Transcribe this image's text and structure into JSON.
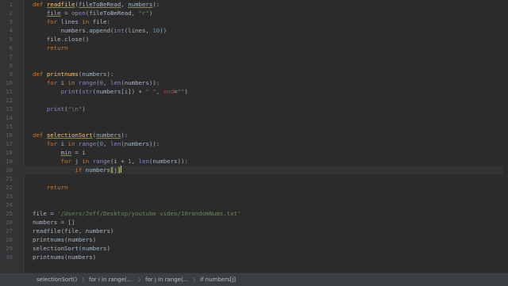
{
  "lines": [
    {
      "n": "1",
      "tokens": [
        {
          "t": "def ",
          "c": "kw"
        },
        {
          "t": "readfile",
          "c": "fn uline"
        },
        {
          "t": "(",
          "c": ""
        },
        {
          "t": "fileToBeRead",
          "c": "param uline"
        },
        {
          "t": ", ",
          "c": ""
        },
        {
          "t": "numbers",
          "c": "param uline"
        },
        {
          "t": "):",
          "c": ""
        }
      ]
    },
    {
      "n": "2",
      "tokens": [
        {
          "t": "    ",
          "c": ""
        },
        {
          "t": "file",
          "c": "uline"
        },
        {
          "t": " = ",
          "c": ""
        },
        {
          "t": "open",
          "c": "builtin"
        },
        {
          "t": "(fileToBeRead, ",
          "c": ""
        },
        {
          "t": "\"r\"",
          "c": "str"
        },
        {
          "t": ")",
          "c": ""
        }
      ]
    },
    {
      "n": "3",
      "tokens": [
        {
          "t": "    ",
          "c": ""
        },
        {
          "t": "for ",
          "c": "kw"
        },
        {
          "t": "lines ",
          "c": ""
        },
        {
          "t": "in ",
          "c": "kw"
        },
        {
          "t": "file:",
          "c": ""
        }
      ]
    },
    {
      "n": "4",
      "tokens": [
        {
          "t": "        numbers.append(",
          "c": ""
        },
        {
          "t": "int",
          "c": "builtin"
        },
        {
          "t": "(lines, ",
          "c": ""
        },
        {
          "t": "10",
          "c": "num"
        },
        {
          "t": "))",
          "c": ""
        }
      ]
    },
    {
      "n": "5",
      "tokens": [
        {
          "t": "    file.close()",
          "c": ""
        }
      ]
    },
    {
      "n": "6",
      "tokens": [
        {
          "t": "    ",
          "c": ""
        },
        {
          "t": "return",
          "c": "kw"
        }
      ]
    },
    {
      "n": "7",
      "tokens": []
    },
    {
      "n": "8",
      "tokens": []
    },
    {
      "n": "9",
      "tokens": [
        {
          "t": "def ",
          "c": "kw"
        },
        {
          "t": "printnums",
          "c": "fn"
        },
        {
          "t": "(numbers):",
          "c": ""
        }
      ]
    },
    {
      "n": "10",
      "tokens": [
        {
          "t": "    ",
          "c": ""
        },
        {
          "t": "for ",
          "c": "kw"
        },
        {
          "t": "i ",
          "c": ""
        },
        {
          "t": "in ",
          "c": "kw"
        },
        {
          "t": "range",
          "c": "builtin"
        },
        {
          "t": "(",
          "c": ""
        },
        {
          "t": "0",
          "c": "num"
        },
        {
          "t": ", ",
          "c": ""
        },
        {
          "t": "len",
          "c": "builtin"
        },
        {
          "t": "(numbers)):",
          "c": ""
        }
      ]
    },
    {
      "n": "11",
      "tokens": [
        {
          "t": "        ",
          "c": ""
        },
        {
          "t": "print",
          "c": "builtin"
        },
        {
          "t": "(",
          "c": ""
        },
        {
          "t": "str",
          "c": "builtin"
        },
        {
          "t": "(numbers[i]) + ",
          "c": ""
        },
        {
          "t": "\" \"",
          "c": "str"
        },
        {
          "t": ", ",
          "c": ""
        },
        {
          "t": "end",
          "c": "kwarg"
        },
        {
          "t": "=",
          "c": ""
        },
        {
          "t": "\"\"",
          "c": "str"
        },
        {
          "t": ")",
          "c": ""
        }
      ]
    },
    {
      "n": "12",
      "tokens": []
    },
    {
      "n": "13",
      "tokens": [
        {
          "t": "    ",
          "c": ""
        },
        {
          "t": "print",
          "c": "builtin"
        },
        {
          "t": "(",
          "c": ""
        },
        {
          "t": "\"\\n\"",
          "c": "str"
        },
        {
          "t": ")",
          "c": ""
        }
      ]
    },
    {
      "n": "14",
      "tokens": []
    },
    {
      "n": "15",
      "tokens": []
    },
    {
      "n": "16",
      "tokens": [
        {
          "t": "def ",
          "c": "kw"
        },
        {
          "t": "selectionSort",
          "c": "fn uline"
        },
        {
          "t": "(",
          "c": ""
        },
        {
          "t": "numbers",
          "c": "uline"
        },
        {
          "t": "):",
          "c": ""
        }
      ]
    },
    {
      "n": "17",
      "tokens": [
        {
          "t": "    ",
          "c": ""
        },
        {
          "t": "for ",
          "c": "kw"
        },
        {
          "t": "i ",
          "c": ""
        },
        {
          "t": "in ",
          "c": "kw"
        },
        {
          "t": "range",
          "c": "builtin"
        },
        {
          "t": "(",
          "c": ""
        },
        {
          "t": "0",
          "c": "num"
        },
        {
          "t": ", ",
          "c": ""
        },
        {
          "t": "len",
          "c": "builtin"
        },
        {
          "t": "(numbers)):",
          "c": ""
        }
      ]
    },
    {
      "n": "18",
      "tokens": [
        {
          "t": "        ",
          "c": ""
        },
        {
          "t": "min",
          "c": "uline"
        },
        {
          "t": " = i",
          "c": ""
        }
      ]
    },
    {
      "n": "19",
      "tokens": [
        {
          "t": "        ",
          "c": ""
        },
        {
          "t": "for ",
          "c": "kw"
        },
        {
          "t": "j ",
          "c": ""
        },
        {
          "t": "in ",
          "c": "kw"
        },
        {
          "t": "range",
          "c": "builtin"
        },
        {
          "t": "(i + ",
          "c": ""
        },
        {
          "t": "1",
          "c": "num"
        },
        {
          "t": ", ",
          "c": ""
        },
        {
          "t": "len",
          "c": "builtin"
        },
        {
          "t": "(numbers)):",
          "c": ""
        }
      ]
    },
    {
      "n": "20",
      "current": true,
      "tokens": [
        {
          "t": "            ",
          "c": ""
        },
        {
          "t": "if ",
          "c": "kw"
        },
        {
          "t": "numbers",
          "c": ""
        },
        {
          "t": "[",
          "c": "br"
        },
        {
          "t": "j",
          "c": ""
        },
        {
          "t": "]",
          "c": "br"
        }
      ]
    },
    {
      "n": "21",
      "tokens": []
    },
    {
      "n": "22",
      "tokens": [
        {
          "t": "    ",
          "c": ""
        },
        {
          "t": "return",
          "c": "kw"
        }
      ]
    },
    {
      "n": "23",
      "tokens": []
    },
    {
      "n": "24",
      "tokens": []
    },
    {
      "n": "25",
      "tokens": [
        {
          "t": "file = ",
          "c": ""
        },
        {
          "t": "'/Users/Jeff/Desktop/youtube video/10randomNums.txt'",
          "c": "str"
        }
      ]
    },
    {
      "n": "26",
      "tokens": [
        {
          "t": "numbers = []",
          "c": ""
        }
      ]
    },
    {
      "n": "27",
      "tokens": [
        {
          "t": "readfile(file, numbers)",
          "c": ""
        }
      ]
    },
    {
      "n": "28",
      "tokens": [
        {
          "t": "printnums(numbers)",
          "c": ""
        }
      ]
    },
    {
      "n": "29",
      "tokens": [
        {
          "t": "selectionSort(numbers)",
          "c": ""
        }
      ]
    },
    {
      "n": "30",
      "tokens": [
        {
          "t": "printnums(numbers)",
          "c": ""
        }
      ]
    }
  ],
  "breadcrumbs": [
    "selectionSort()",
    "for i in range(...",
    "for j in range(...",
    "if numbers[j]"
  ],
  "breadcrumb_separator": "〉",
  "colors": {
    "background": "#2b2b2b",
    "keyword": "#cc7832",
    "function": "#ffc66d",
    "string": "#6a8759",
    "number": "#6897bb",
    "builtin": "#8888c6",
    "text": "#a9b7c6"
  }
}
